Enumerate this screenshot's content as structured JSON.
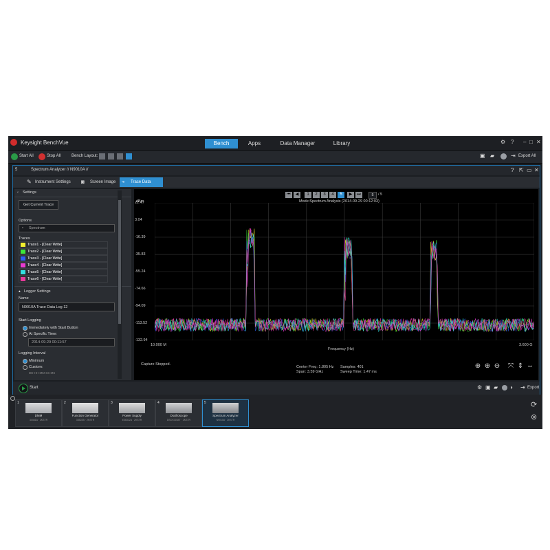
{
  "app": {
    "title": "Keysight BenchVue",
    "tabs": [
      "Bench",
      "Apps",
      "Data Manager",
      "Library"
    ],
    "active_tab": "Bench",
    "accent_color": "#2f8fd1"
  },
  "toolbar": {
    "start_all": "Start All",
    "stop_all": "Stop All",
    "bench_layout_label": "Bench Layout:",
    "export_all": "Export All"
  },
  "panel": {
    "number": "5",
    "title": "Spectrum Analyzer // N9010A //",
    "subtabs": [
      "Instrument Settings",
      "Screen Image",
      "Trace Data"
    ],
    "active_subtab": "Trace Data"
  },
  "settings": {
    "header": "Settings",
    "get_trace_button": "Get Current Trace",
    "options_label": "Options",
    "options_value": "Spectrum",
    "traces_label": "Traces",
    "traces": [
      {
        "label": "Trace1 - [Clear Write]",
        "color": "#f2ef2e"
      },
      {
        "label": "Trace2 - [Clear Write]",
        "color": "#3de83a"
      },
      {
        "label": "Trace3 - [Clear Write]",
        "color": "#2e5ef2"
      },
      {
        "label": "Trace4 - [Clear Write]",
        "color": "#e83ad0"
      },
      {
        "label": "Trace5 - [Clear Write]",
        "color": "#32e0e0"
      },
      {
        "label": "Trace6 - [Clear Write]",
        "color": "#e63a9a"
      }
    ],
    "logger_header": "Logger Settings",
    "name_label": "Name",
    "name_value": "N9010A Trace Data Log 12",
    "start_logging_label": "Start Logging",
    "immediately_option": "Immediately with Start Button",
    "specific_time_option": "At Specific Time:",
    "specific_time_value": "2014-09-29 00:11:57",
    "interval_label": "Logging Interval",
    "minimum_option": "Minimum",
    "custom_option": "Custom:",
    "custom_placeholder": "DD HH MM SS MS"
  },
  "plot": {
    "pages": [
      "1",
      "2",
      "3",
      "4",
      "5"
    ],
    "active_page": "5",
    "page_input": "5",
    "page_total": "/ 5",
    "mode_line": "Mode:Spectrum Analysis (2014-09-29 00:12:03)",
    "status": "Capture Stopped.",
    "center_freq": "Center Freq: 1.805 Hz",
    "span": "Span: 3.59 GHz",
    "samples": "Samples: 401",
    "sweep_time": "Sweep Time: 1.47 ms"
  },
  "chart_data": {
    "type": "line",
    "title": "Mode:Spectrum Analysis (2014-09-29 00:12:03)",
    "xlabel": "Frequency (Hz)",
    "ylabel": "dBm",
    "x_tick_labels": [
      "10.000 M",
      "3.600 G"
    ],
    "xlim_hz": [
      10000000,
      3600000000
    ],
    "y_ticks": [
      22.47,
      3.04,
      -16.39,
      -35.83,
      -55.24,
      -74.66,
      -94.09,
      -113.52,
      -132.94
    ],
    "ylim": [
      -132.94,
      22.47
    ],
    "grid": true,
    "noise_floor_range_dbm": [
      -123,
      -108
    ],
    "series": [
      {
        "name": "Trace1",
        "color": "#f2ef2e"
      },
      {
        "name": "Trace2",
        "color": "#3de83a"
      },
      {
        "name": "Trace3",
        "color": "#2e5ef2"
      },
      {
        "name": "Trace4",
        "color": "#e83ad0"
      },
      {
        "name": "Trace5",
        "color": "#32e0e0"
      },
      {
        "name": "Trace6",
        "color": "#e63a9a"
      }
    ],
    "signal_bands": [
      {
        "start_hz": 880000000,
        "end_hz": 960000000,
        "peak_dbm": 2
      },
      {
        "start_hz": 1805000000,
        "end_hz": 1880000000,
        "peak_dbm": -8
      },
      {
        "start_hz": 2620000000,
        "end_hz": 2690000000,
        "peak_dbm": -10
      }
    ]
  },
  "footer": {
    "start": "Start",
    "export": "Export"
  },
  "shelf": {
    "items": [
      {
        "num": "1",
        "label": "DMM",
        "sub": "34461A · 2KSTR"
      },
      {
        "num": "2",
        "label": "Function Generator",
        "sub": "33522B · 2KSTR"
      },
      {
        "num": "3",
        "label": "Power Supply",
        "sub": "E36312A · 2KSTR"
      },
      {
        "num": "4",
        "label": "Oscilloscope",
        "sub": "DSOX3034T · 2KSTR"
      },
      {
        "num": "5",
        "label": "Spectrum Analyzer",
        "sub": "N9010A · 2KSTR"
      }
    ],
    "selected": "5"
  }
}
